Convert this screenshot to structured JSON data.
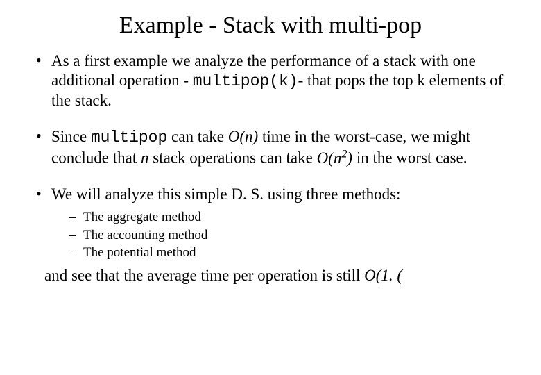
{
  "title": "Example - Stack with multi-pop",
  "bullets": {
    "b1": {
      "t1": "As a first example we analyze the performance of a stack with one additional operation - ",
      "code": "multipop(k)",
      "t2": "- that pops the top k elements of the stack."
    },
    "b2": {
      "t1": "Since ",
      "code": "multipop",
      "t2": " can take ",
      "on": "O(n)",
      "t3": " time in the worst-case, we might conclude that ",
      "n": "n",
      "t4": " stack operations can take ",
      "on2a": "O(n",
      "on2b": "2",
      "on2c": ")",
      "t5": " in the worst case."
    },
    "b3": {
      "t1": "We will analyze this simple D. S. using three methods:",
      "sub": [
        "The aggregate method",
        "The accounting method",
        "The potential method"
      ],
      "closing_a": "and see that the average time per operation is still ",
      "closing_b": "O(1. ("
    }
  }
}
